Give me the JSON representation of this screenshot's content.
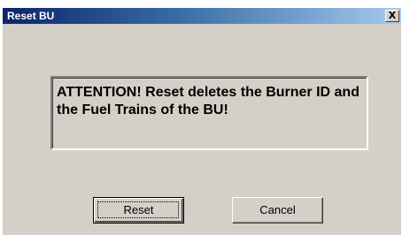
{
  "window": {
    "title": "Reset BU",
    "close_label": "X"
  },
  "message": {
    "text": "ATTENTION! Reset deletes the Burner ID and the Fuel Trains of the BU!"
  },
  "buttons": {
    "reset_label": "Reset",
    "cancel_label": "Cancel"
  },
  "colors": {
    "dialog_background": "#d4d0c8",
    "titlebar_start": "#0a246a",
    "titlebar_end": "#a6caf0",
    "title_text": "#ffffff"
  }
}
